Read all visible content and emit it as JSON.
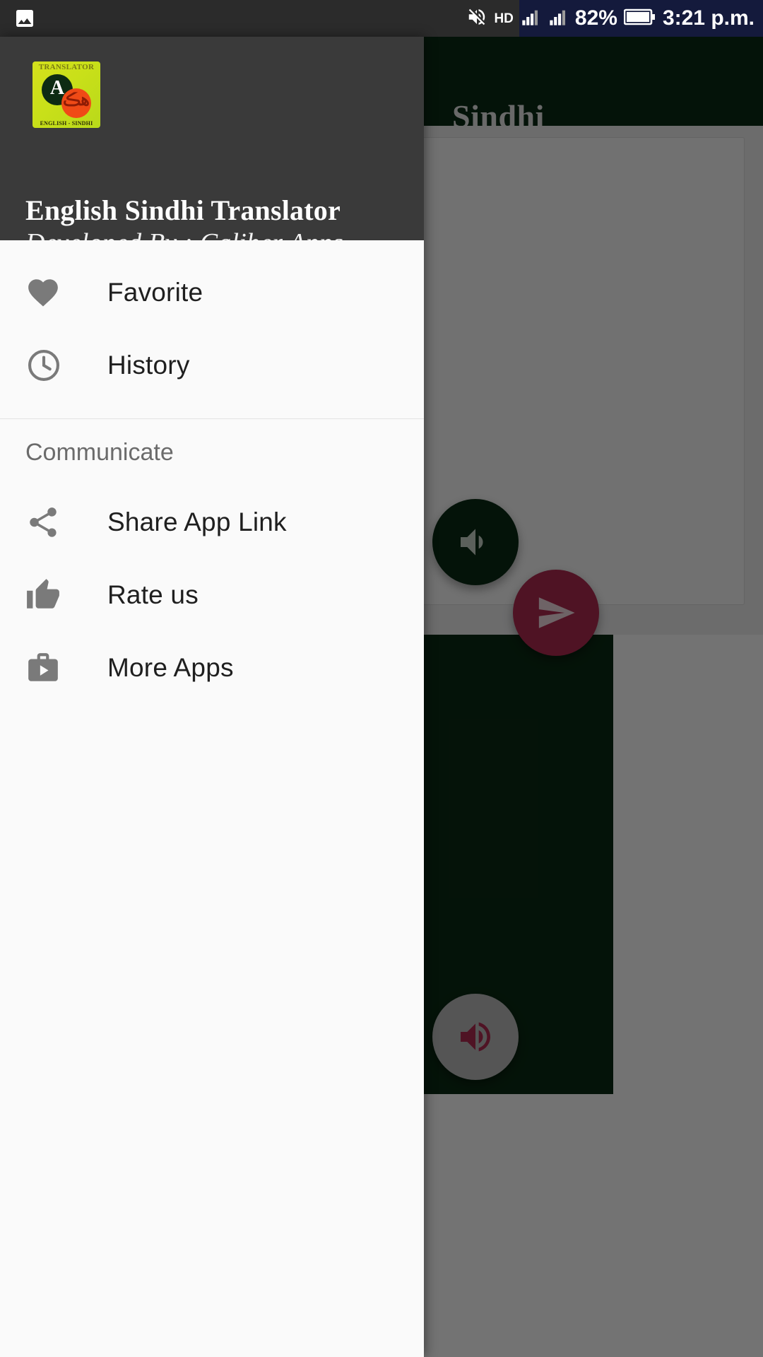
{
  "status_bar": {
    "left_icon": "image-icon",
    "icons": [
      "mute-icon",
      "hd-icon",
      "signal-1-icon",
      "signal-2-icon"
    ],
    "hd_label": "HD",
    "battery_percent": "82%",
    "battery_icon": "battery-icon",
    "time": "3:21 p.m."
  },
  "background_app": {
    "app_bar_title": "Sindhi",
    "speaker_top_icon": "speaker-icon",
    "send_icon": "send-icon",
    "speaker_bottom_icon": "speaker-icon",
    "accent_dark_green": "#0b2b14",
    "accent_crimson": "#b02a50"
  },
  "drawer": {
    "logo": {
      "name": "app-logo-icon",
      "top_text": "TRANSLATOR",
      "letter": "A",
      "script_letter": "هڪ",
      "bottom_text": "ENGLISH - SINDHI"
    },
    "app_name": "English Sindhi Translator",
    "developer": "Developed By : Caliber Apps",
    "primary_items": [
      {
        "label": "Favorite",
        "icon": "heart-icon"
      },
      {
        "label": "History",
        "icon": "clock-icon"
      }
    ],
    "section_label": "Communicate",
    "communicate_items": [
      {
        "label": "Share App Link",
        "icon": "share-icon"
      },
      {
        "label": "Rate us",
        "icon": "thumbs-up-icon"
      },
      {
        "label": "More Apps",
        "icon": "briefcase-play-icon"
      }
    ]
  }
}
